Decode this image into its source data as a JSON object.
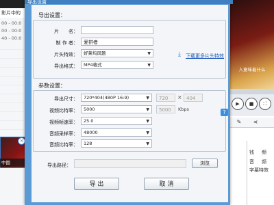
{
  "background": {
    "left_header": "影片中的",
    "timecodes": [
      "00 - 00:0",
      "00 - 00:0",
      "40 - 00:0"
    ],
    "thumb_caption": "中国",
    "video_subtitle": "人意味着什么",
    "right_panel_text": [
      "钱",
      "频",
      "音",
      "频",
      "字幕特效"
    ]
  },
  "dialog": {
    "title": "导出设置",
    "export_settings": {
      "section_label": "导出设置：",
      "name_label": "片　　名：",
      "name_value": "",
      "author_label": "制 作 者：",
      "author_value": "爱拼者",
      "opening_label": "片头特效：",
      "opening_value": "好莱坞风题",
      "download_link": "下载更多片头特效",
      "format_label": "导出格式：",
      "format_value": "MP4格式"
    },
    "param_settings": {
      "section_label": "参数设置：",
      "size_label": "导出尺寸：",
      "size_value": "720*404(480P 16:9)",
      "width_value": "720",
      "times_sign": "×",
      "height_value": "404",
      "vbitrate_label": "视频比特率：",
      "vbitrate_value": "5000",
      "vbitrate_custom": "5000",
      "kbps": "Kbps",
      "help_label": "?",
      "framerate_label": "视频帧速率：",
      "framerate_value": "25.0",
      "samplerate_label": "音频采样率：",
      "samplerate_value": "48000",
      "abitrate_label": "音频比特率：",
      "abitrate_value": "128"
    },
    "path": {
      "label": "导出路径：",
      "value": "",
      "browse_label": "浏览"
    },
    "export_button": "导 出",
    "cancel_button": "取 消"
  },
  "colors": {
    "dialog_frame": "#5b9bd5",
    "dialog_body": "#f3f5f8",
    "link": "#1a56b8"
  }
}
